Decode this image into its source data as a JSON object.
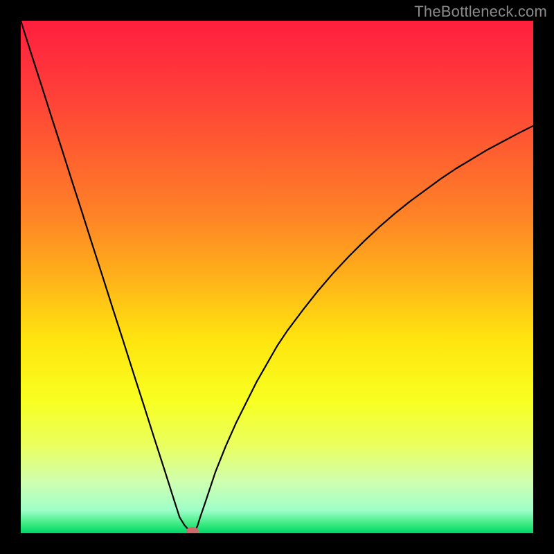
{
  "watermark": "TheBottleneck.com",
  "chart_data": {
    "type": "line",
    "title": "",
    "xlabel": "",
    "ylabel": "",
    "xlim": [
      0,
      100
    ],
    "ylim": [
      0,
      100
    ],
    "grid": false,
    "x": [
      0,
      2,
      4,
      6,
      8,
      10,
      12,
      14,
      16,
      18,
      20,
      22,
      24,
      26,
      28,
      30,
      31,
      32,
      33,
      33.5,
      34,
      34.5,
      35,
      36,
      37,
      38,
      40,
      42,
      44,
      46,
      48,
      50,
      52,
      55,
      58,
      61,
      64,
      67,
      70,
      73,
      76,
      79,
      82,
      85,
      88,
      91,
      94,
      97,
      100
    ],
    "y": [
      100,
      93.7,
      87.5,
      81.2,
      75.0,
      68.7,
      62.5,
      56.2,
      50.0,
      43.7,
      37.5,
      31.2,
      25.0,
      18.7,
      12.5,
      6.2,
      3.1,
      1.5,
      0.4,
      0.0,
      0.4,
      1.5,
      3.1,
      6.0,
      9.0,
      12.0,
      17.0,
      21.5,
      25.5,
      29.5,
      33.0,
      36.5,
      39.5,
      43.5,
      47.3,
      50.8,
      54.0,
      57.0,
      59.8,
      62.4,
      64.8,
      67.0,
      69.2,
      71.2,
      73.0,
      74.8,
      76.4,
      78.0,
      79.5
    ],
    "minimum_x": 33.5,
    "marker": {
      "x": 33.5,
      "y": 0,
      "color": "#cf6a6a"
    },
    "background_gradient": {
      "stops": [
        {
          "offset": 0.0,
          "color": "#ff1f3f"
        },
        {
          "offset": 0.12,
          "color": "#ff3a3a"
        },
        {
          "offset": 0.25,
          "color": "#ff5d30"
        },
        {
          "offset": 0.38,
          "color": "#ff8326"
        },
        {
          "offset": 0.5,
          "color": "#ffb11a"
        },
        {
          "offset": 0.62,
          "color": "#ffe40f"
        },
        {
          "offset": 0.74,
          "color": "#f8ff20"
        },
        {
          "offset": 0.83,
          "color": "#eaff60"
        },
        {
          "offset": 0.9,
          "color": "#cfffb0"
        },
        {
          "offset": 0.955,
          "color": "#9fffc8"
        },
        {
          "offset": 0.985,
          "color": "#30e87a"
        },
        {
          "offset": 1.0,
          "color": "#00d66a"
        }
      ]
    }
  }
}
